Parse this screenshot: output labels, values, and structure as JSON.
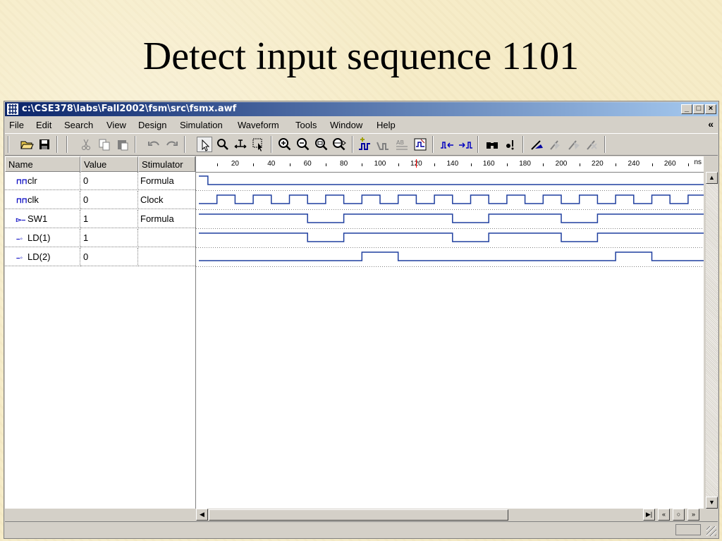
{
  "slide": {
    "title": "Detect input sequence 1101"
  },
  "window": {
    "title": "c:\\CSE378\\labs\\Fall2002\\fsm\\src\\fsmx.awf",
    "controls": {
      "minimize": "_",
      "maximize": "□",
      "close": "×"
    }
  },
  "menu": {
    "items": [
      {
        "label": "File"
      },
      {
        "label": "Edit"
      },
      {
        "label": "Search"
      },
      {
        "label": "View"
      },
      {
        "label": "Design"
      },
      {
        "label": "Simulation"
      },
      {
        "label": "Waveform"
      },
      {
        "label": "Tools"
      },
      {
        "label": "Window"
      },
      {
        "label": "Help"
      }
    ],
    "chevron": "«"
  },
  "table": {
    "headers": {
      "name": "Name",
      "value": "Value",
      "stimulator": "Stimulator"
    },
    "rows": [
      {
        "name": "clr",
        "value": "0",
        "stimulator": "Formula",
        "icon": "input-signal-icon"
      },
      {
        "name": "clk",
        "value": "0",
        "stimulator": "Clock",
        "icon": "input-signal-icon"
      },
      {
        "name": "SW1",
        "value": "1",
        "stimulator": "Formula",
        "icon": "input-pin-icon"
      },
      {
        "name": "LD(1)",
        "value": "1",
        "stimulator": "",
        "icon": "output-pin-icon"
      },
      {
        "name": "LD(2)",
        "value": "0",
        "stimulator": "",
        "icon": "output-pin-icon"
      }
    ]
  },
  "ruler": {
    "unit": "ns",
    "labels": [
      "20",
      "40",
      "60",
      "80",
      "100",
      "120",
      "140",
      "160",
      "180",
      "200",
      "220",
      "240",
      "260"
    ],
    "cursor_time": 120
  },
  "waveforms": {
    "time_range": [
      0,
      280
    ],
    "wave_color": "#1f3f9f",
    "clr": [
      [
        0,
        1
      ],
      [
        5,
        0
      ]
    ],
    "clk": {
      "period": 20,
      "first_rise": 10,
      "high_time": 10
    },
    "SW1": [
      [
        0,
        1
      ],
      [
        60,
        0
      ],
      [
        80,
        1
      ],
      [
        140,
        0
      ],
      [
        160,
        1
      ],
      [
        200,
        0
      ],
      [
        220,
        1
      ]
    ],
    "LD(1)": [
      [
        0,
        1
      ],
      [
        60,
        0
      ],
      [
        80,
        1
      ],
      [
        140,
        0
      ],
      [
        160,
        1
      ],
      [
        200,
        0
      ],
      [
        220,
        1
      ]
    ],
    "LD(2)": [
      [
        0,
        0
      ],
      [
        90,
        1
      ],
      [
        110,
        0
      ],
      [
        230,
        1
      ],
      [
        250,
        0
      ]
    ]
  },
  "colors": {
    "accent_title_bar": "#0a246a",
    "cursor_marker": "#ff0000"
  }
}
